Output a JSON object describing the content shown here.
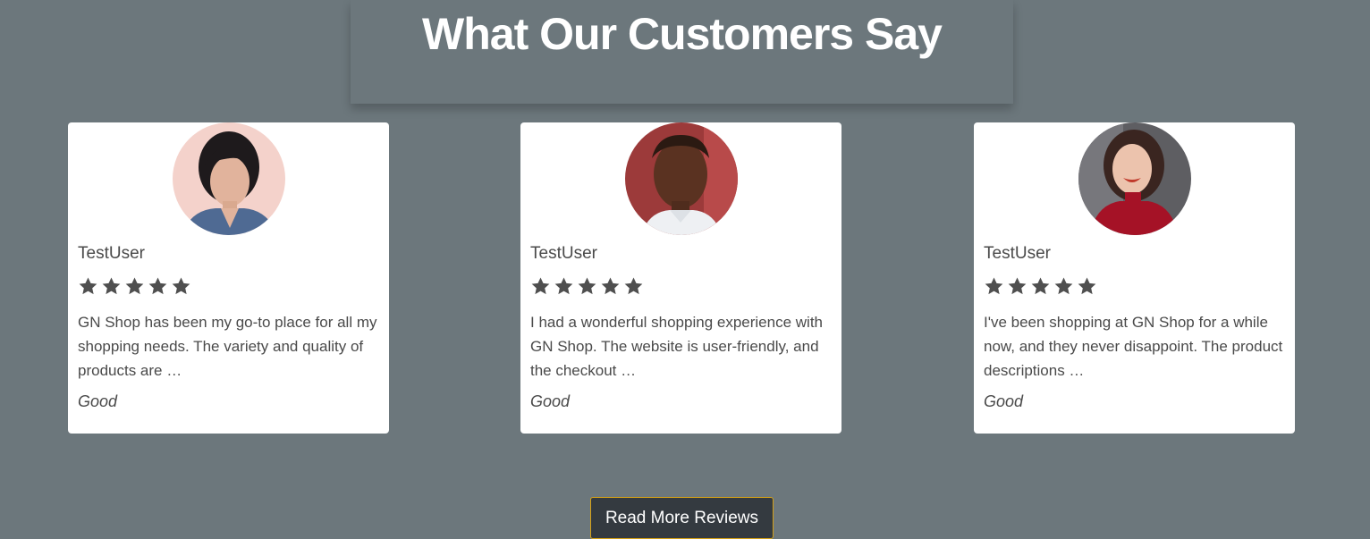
{
  "section": {
    "title": "What Our Customers Say"
  },
  "reviews": [
    {
      "reviewer": "TestUser",
      "stars": 5,
      "text": "GN Shop has been my go-to place for all my shopping needs. The variety and quality of products are …",
      "rating_word": "Good",
      "avatar_bg": "#f4d2cb"
    },
    {
      "reviewer": "TestUser",
      "stars": 5,
      "text": "I had a wonderful shopping experience with GN Shop. The website is user-friendly, and the checkout …",
      "rating_word": "Good",
      "avatar_bg": "#9c3a3a"
    },
    {
      "reviewer": "TestUser",
      "stars": 5,
      "text": "I've been shopping at GN Shop for a while now, and they never disappoint. The product descriptions …",
      "rating_word": "Good",
      "avatar_bg": "#5e5e62"
    }
  ],
  "actions": {
    "read_more_label": "Read More Reviews"
  },
  "colors": {
    "page_bg": "#6c777c",
    "card_bg": "#ffffff",
    "star": "#4f4f4f",
    "button_bg": "#343a40",
    "button_border": "#d4a017"
  }
}
